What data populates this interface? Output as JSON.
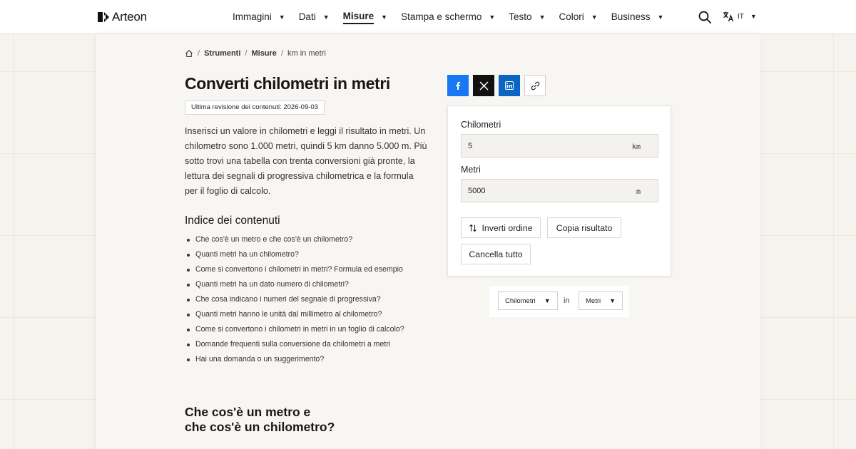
{
  "brand": {
    "name": "Arteon"
  },
  "nav": {
    "items": [
      {
        "label": "Immagini",
        "active": false
      },
      {
        "label": "Dati",
        "active": false
      },
      {
        "label": "Misure",
        "active": true
      },
      {
        "label": "Stampa e schermo",
        "active": false
      },
      {
        "label": "Testo",
        "active": false
      },
      {
        "label": "Colori",
        "active": false
      },
      {
        "label": "Business",
        "active": false
      }
    ],
    "caret": "▼",
    "search_icon": "search-icon",
    "language": {
      "code": "IT",
      "icon": "translate-icon"
    }
  },
  "breadcrumb": {
    "home_icon": "home-icon",
    "separator": "/",
    "items": [
      "Strumenti",
      "Misure"
    ],
    "current": "km in metri"
  },
  "page": {
    "title": "Converti chilometri in metri",
    "revision": "Ultima revisione dei contenuti: 2026-09-03",
    "intro": "Inserisci un valore in chilometri e leggi il risultato in metri. Un chilometro sono 1.000 metri, quindi 5 km danno 5.000 m. Più sotto trovi una tabella con trenta conversioni già pronte, la lettura dei segnali di progressiva chilometrica e la formula per il foglio di calcolo."
  },
  "toc": {
    "title": "Indice dei contenuti",
    "items": [
      "Che cos'è un metro e che cos'è un chilometro?",
      "Quanti metri ha un chilometro?",
      "Come si convertono i chilometri in metri? Formula ed esempio",
      "Quanti metri ha un dato numero di chilometri?",
      "Che cosa indicano i numeri del segnale di progressiva?",
      "Quanti metri hanno le unità dal millimetro al chilometro?",
      "Come si convertono i chilometri in metri in un foglio di calcolo?",
      "Domande frequenti sulla conversione da chilometri a metri",
      "Hai una domanda o un suggerimento?"
    ]
  },
  "section": {
    "title_line1": "Che cos'è un metro e",
    "title_line2": "che cos'è un chilometro?"
  },
  "share": {
    "icons": [
      "facebook-icon",
      "x-icon",
      "linkedin-icon",
      "link-icon"
    ],
    "colors": {
      "facebook": "#1877f2",
      "x": "#111111",
      "linkedin": "#0a66c2"
    }
  },
  "converter": {
    "from": {
      "label": "Chilometri",
      "value": "5",
      "unit": "km"
    },
    "to": {
      "label": "Metri",
      "value": "5000",
      "unit": "m"
    },
    "swap_label": "Inverti ordine",
    "swap_icon": "swap-vertical-icon",
    "copy_label": "Copia risultato",
    "clear_label": "Cancella tutto"
  },
  "unit_selector": {
    "from_unit": "Chilometri",
    "connector": "in",
    "to_unit": "Metri"
  }
}
